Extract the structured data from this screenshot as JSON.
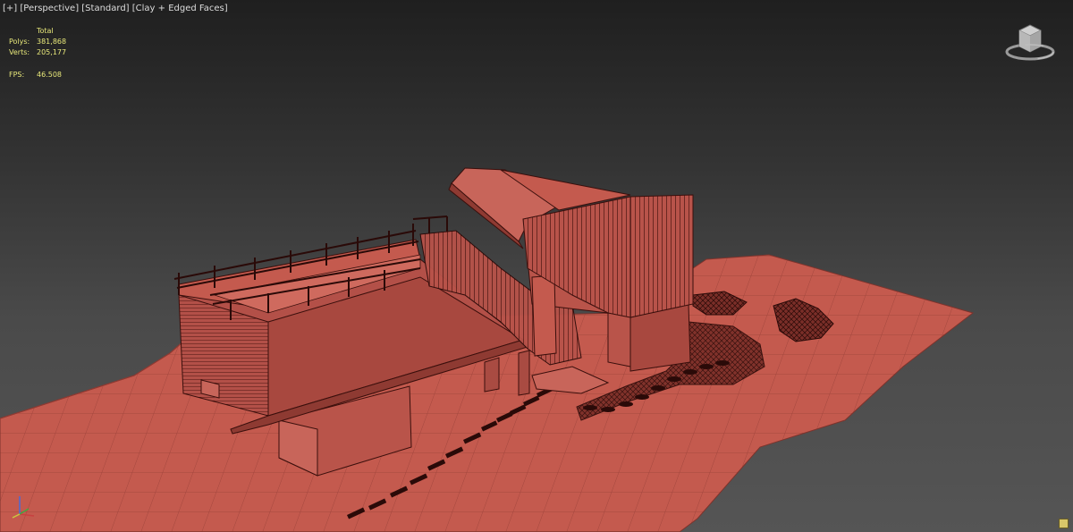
{
  "viewport": {
    "menu": "[+]",
    "view": "[Perspective]",
    "shading_mode": "[Standard]",
    "display_mode": "[Clay + Edged Faces]"
  },
  "stats": {
    "header": "Total",
    "polys_label": "Polys:",
    "polys_value": "381,868",
    "verts_label": "Verts:",
    "verts_value": "205,177",
    "fps_label": "FPS:",
    "fps_value": "46.508"
  },
  "colors": {
    "clay": "#c45a4e",
    "clay_dark": "#8e3a32",
    "edge": "#3a0f0c",
    "stats_text": "#e8e87a",
    "label_text": "#dcdcdc"
  },
  "icons": {
    "viewcube": "viewcube-icon",
    "axis": "axis-tripod-icon",
    "corner": "viewport-corner-button"
  }
}
